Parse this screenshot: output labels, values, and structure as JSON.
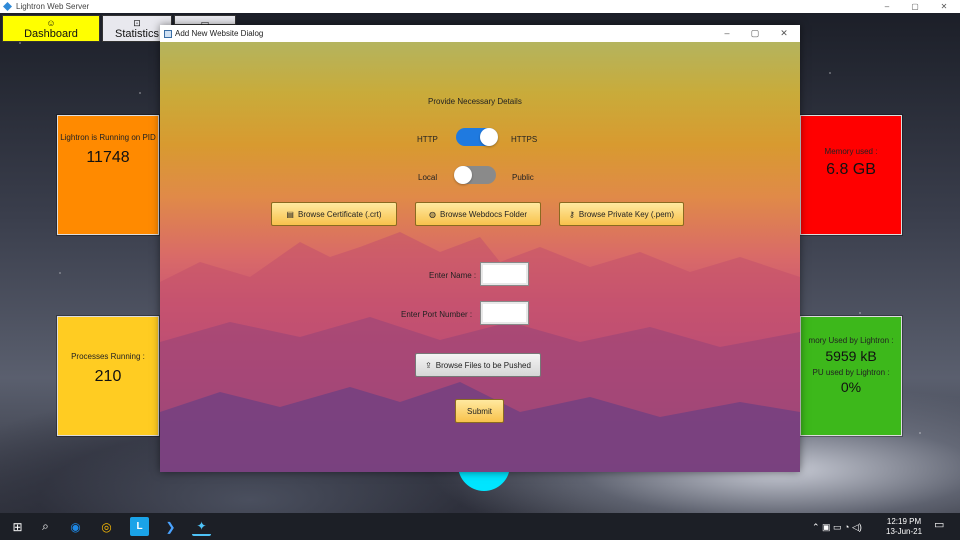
{
  "window": {
    "title": "Lightron Web Server",
    "minimize": "–",
    "maximize": "▢",
    "close": "✕"
  },
  "tabs": [
    {
      "label": "Dashboard",
      "icon": "☺"
    },
    {
      "label": "Statistics",
      "icon": "⊡"
    },
    {
      "label": "",
      "icon": "▭"
    }
  ],
  "cards": {
    "pid": {
      "label": "Lightron is Running on PID",
      "value": "11748"
    },
    "processes": {
      "label": "Processes Running :",
      "value": "210"
    },
    "memory": {
      "label": "Memory used :",
      "value": "6.8 GB"
    },
    "lightron_memory": {
      "label": "mory Used by Lightron :",
      "value": "5959 kB",
      "label2": "PU used by Lightron :",
      "value2": "0%"
    }
  },
  "dialog": {
    "title": "Add New Website Dialog",
    "heading": "Provide Necessary Details",
    "protocol_left": "HTTP",
    "protocol_right": "HTTPS",
    "scope_left": "Local",
    "scope_right": "Public",
    "protocol_toggle_state": "HTTPS",
    "scope_toggle_state": "Local",
    "buttons": {
      "certificate": "Browse Certificate (.crt)",
      "webdocs": "Browse Webdocs Folder",
      "private_key": "Browse Private Key (.pem)",
      "push_files": "Browse Files to be Pushed",
      "submit": "Submit"
    },
    "name_label": "Enter Name :",
    "name_value": "",
    "port_label": "Enter Port Number :",
    "port_value": ""
  },
  "taskbar": {
    "time": "12:19 PM",
    "date": "13-Jun-21",
    "colors": {
      "background": "#1c1f26",
      "edge": "#1e88e5",
      "lightron": "#1aa3e8"
    }
  },
  "colors": {
    "dashboard_tab": "#ffff00",
    "pid_card": "#ff8a00",
    "processes_card": "#ffcc22",
    "memory_card": "#ff0000",
    "lightron_card": "#3db81b",
    "toggle_on": "#1f7ae0"
  }
}
